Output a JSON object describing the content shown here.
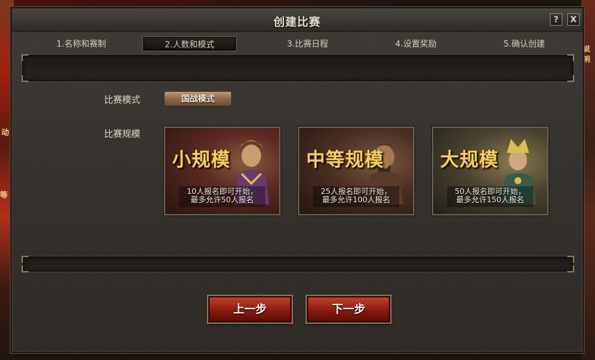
{
  "window": {
    "title": "创建比赛",
    "help_label": "?",
    "close_label": "X"
  },
  "steps": [
    {
      "label": "1.名称和赛制",
      "active": false
    },
    {
      "label": "2.人数和模式",
      "active": true
    },
    {
      "label": "3.比赛日程",
      "active": false
    },
    {
      "label": "4.设置奖励",
      "active": false
    },
    {
      "label": "5.确认创建",
      "active": false
    }
  ],
  "form": {
    "mode_label": "比赛模式",
    "mode_value": "国战模式",
    "scale_label": "比赛规模"
  },
  "scales": [
    {
      "title": "小规模",
      "desc_line1": "10人报名即可开始，",
      "desc_line2": "最多允许50人报名",
      "color": "#5a2a22"
    },
    {
      "title": "中等规模",
      "desc_line1": "25人报名即可开始，",
      "desc_line2": "最多允许100人报名",
      "color": "#4a2e22"
    },
    {
      "title": "大规模",
      "desc_line1": "50人报名即可开始，",
      "desc_line2": "最多允许150人报名",
      "color": "#4a4230"
    }
  ],
  "nav": {
    "prev_label": "上一步",
    "next_label": "下一步"
  },
  "background": {
    "left_text": "动",
    "left_text2": "等",
    "right_text": "说明"
  }
}
